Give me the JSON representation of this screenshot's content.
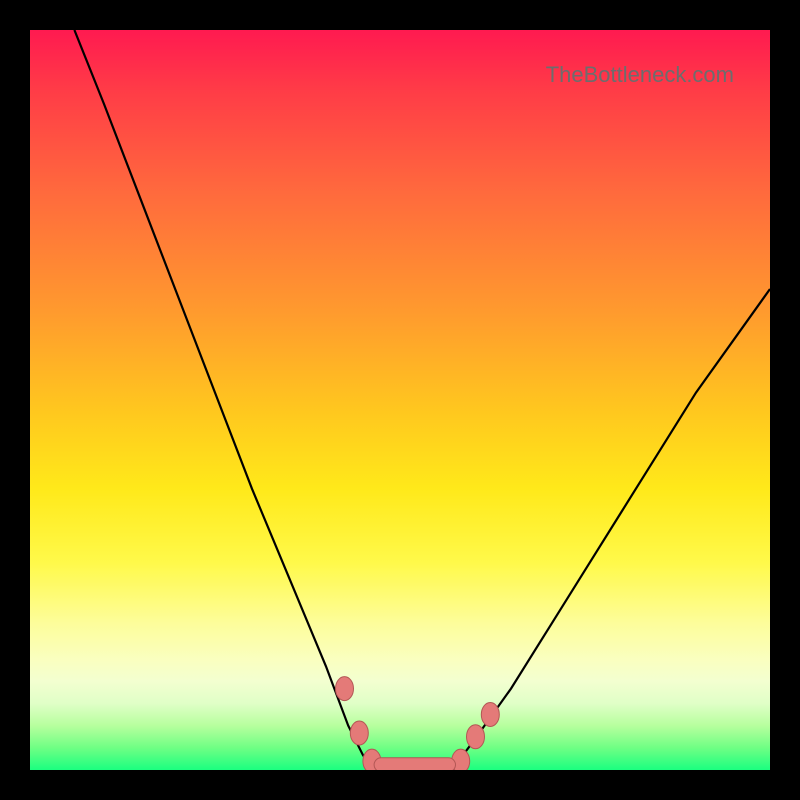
{
  "watermark": "TheBottleneck.com",
  "chart_data": {
    "type": "line",
    "title": "",
    "xlabel": "",
    "ylabel": "",
    "xlim": [
      0,
      100
    ],
    "ylim": [
      0,
      100
    ],
    "series": [
      {
        "name": "left-curve",
        "x": [
          6,
          10,
          15,
          20,
          25,
          30,
          35,
          40,
          43,
          45,
          46.5
        ],
        "values": [
          100,
          90,
          77,
          64,
          51,
          38,
          26,
          14,
          6,
          2,
          0
        ]
      },
      {
        "name": "right-curve",
        "x": [
          57,
          60,
          65,
          70,
          75,
          80,
          85,
          90,
          95,
          100
        ],
        "values": [
          0,
          4,
          11,
          19,
          27,
          35,
          43,
          51,
          58,
          65
        ]
      }
    ],
    "markers": [
      {
        "x": 42.5,
        "y": 11
      },
      {
        "x": 44.5,
        "y": 5
      },
      {
        "x": 46.2,
        "y": 1.2
      },
      {
        "x": 58.2,
        "y": 1.2
      },
      {
        "x": 60.2,
        "y": 4.5
      },
      {
        "x": 62.2,
        "y": 7.5
      }
    ],
    "bottom_bar": {
      "x_start": 46.5,
      "x_end": 57.5,
      "y": 0.7
    }
  }
}
